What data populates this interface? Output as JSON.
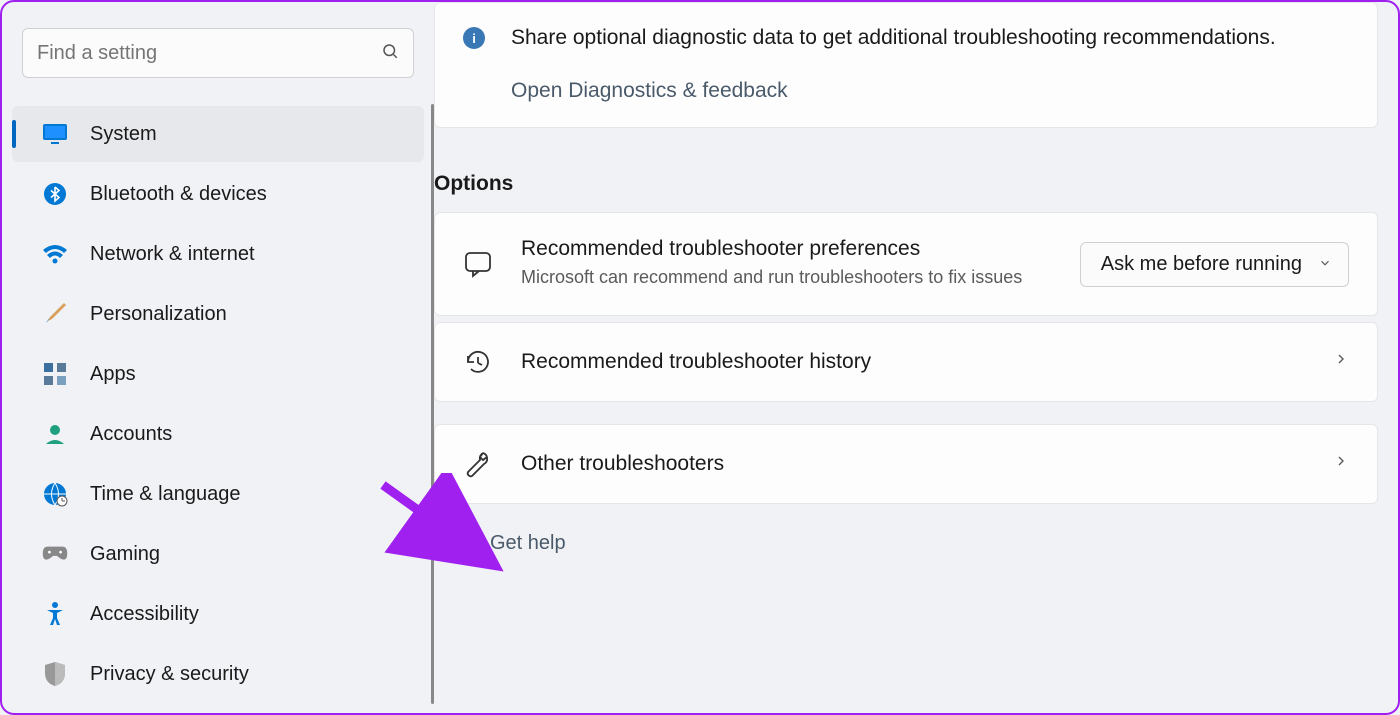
{
  "search": {
    "placeholder": "Find a setting"
  },
  "sidebar": {
    "items": [
      {
        "id": "system",
        "label": "System",
        "icon": "monitor-icon",
        "selected": true
      },
      {
        "id": "bluetooth",
        "label": "Bluetooth & devices",
        "icon": "bluetooth-icon",
        "selected": false
      },
      {
        "id": "network",
        "label": "Network & internet",
        "icon": "wifi-icon",
        "selected": false
      },
      {
        "id": "personalization",
        "label": "Personalization",
        "icon": "brush-icon",
        "selected": false
      },
      {
        "id": "apps",
        "label": "Apps",
        "icon": "apps-icon",
        "selected": false
      },
      {
        "id": "accounts",
        "label": "Accounts",
        "icon": "person-icon",
        "selected": false
      },
      {
        "id": "time",
        "label": "Time & language",
        "icon": "globe-clock-icon",
        "selected": false
      },
      {
        "id": "gaming",
        "label": "Gaming",
        "icon": "gamepad-icon",
        "selected": false
      },
      {
        "id": "accessibility",
        "label": "Accessibility",
        "icon": "accessibility-icon",
        "selected": false
      },
      {
        "id": "privacy",
        "label": "Privacy & security",
        "icon": "shield-icon",
        "selected": false
      }
    ]
  },
  "main": {
    "info": {
      "text": "Share optional diagnostic data to get additional troubleshooting recommendations.",
      "link": "Open Diagnostics & feedback"
    },
    "options_heading": "Options",
    "options": [
      {
        "icon": "chat-icon",
        "title": "Recommended troubleshooter preferences",
        "desc": "Microsoft can recommend and run troubleshooters to fix issues",
        "control": {
          "type": "dropdown",
          "value": "Ask me before running"
        }
      },
      {
        "icon": "history-icon",
        "title": "Recommended troubleshooter history",
        "desc": "",
        "control": {
          "type": "chevron"
        }
      },
      {
        "icon": "wrench-icon",
        "title": "Other troubleshooters",
        "desc": "",
        "control": {
          "type": "chevron"
        }
      }
    ],
    "help_label": "Get help"
  },
  "annotation": {
    "arrow_color": "#a020f0"
  }
}
